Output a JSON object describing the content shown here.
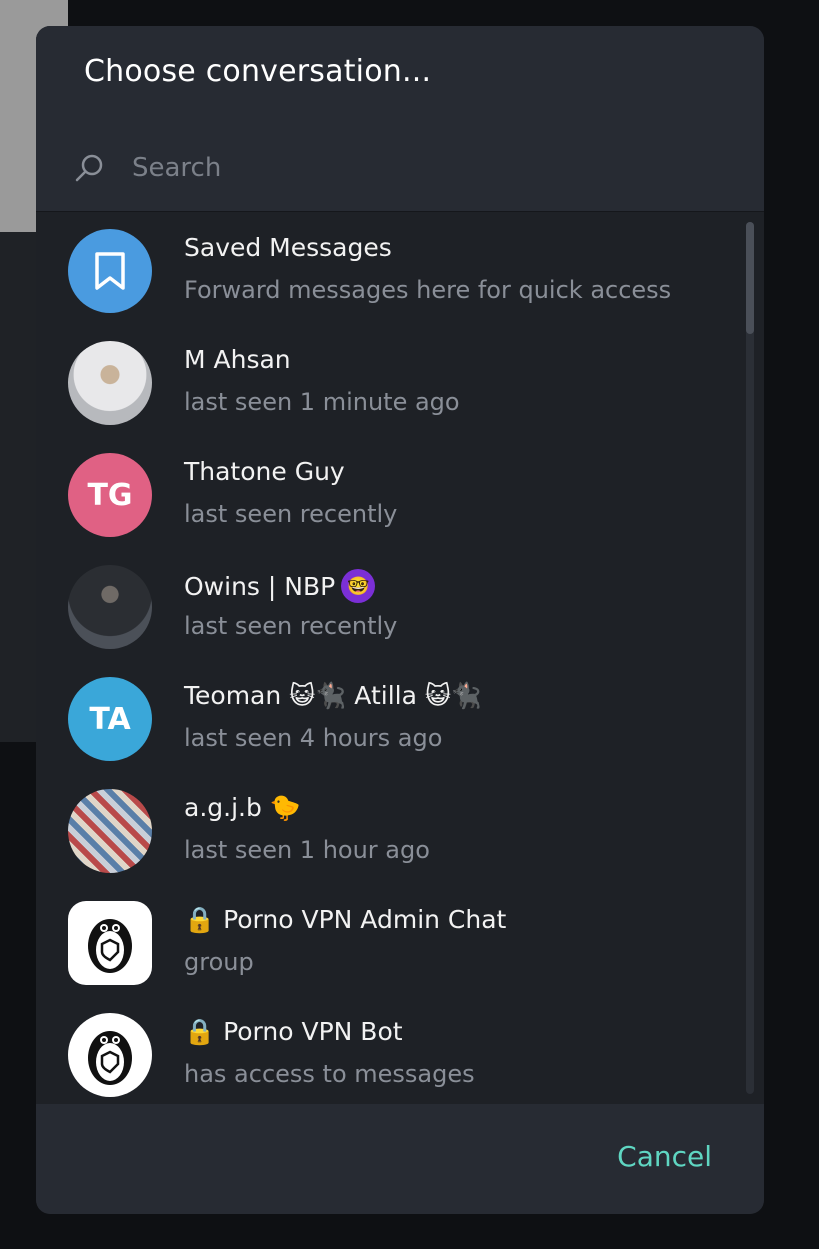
{
  "dialog": {
    "title": "Choose conversation...",
    "search_placeholder": "Search",
    "cancel_label": "Cancel"
  },
  "chats": [
    {
      "name": "Saved Messages",
      "subtitle": "Forward messages here for quick access",
      "avatar": "bookmark-icon",
      "color": "#4a9be0"
    },
    {
      "name": "M Ahsan",
      "subtitle": "last seen 1 minute ago",
      "avatar": "photo"
    },
    {
      "name": "Thatone Guy",
      "subtitle": "last seen recently",
      "initials": "TG",
      "color": "#e06184"
    },
    {
      "name": "Owins | NBP",
      "subtitle": "last seen recently",
      "avatar": "photo",
      "badge": "🤓"
    },
    {
      "name": "Teoman 😺🐈‍⬛ Atilla 😺🐈‍⬛",
      "subtitle": "last seen 4 hours ago",
      "initials": "TA",
      "color": "#3aa7d9"
    },
    {
      "name": "a.g.j.b 🐤",
      "subtitle": "last seen 1 hour ago",
      "avatar": "photo"
    },
    {
      "name": "🔒 Porno VPN Admin Chat",
      "subtitle": "group",
      "avatar": "penguin-logo"
    },
    {
      "name": "🔒 Porno VPN Bot",
      "subtitle": "has access to messages",
      "avatar": "penguin-logo"
    }
  ],
  "colors": {
    "accent": "#5fd6c2",
    "dialog_bg": "#1e2126",
    "header_bg": "#272b33"
  }
}
